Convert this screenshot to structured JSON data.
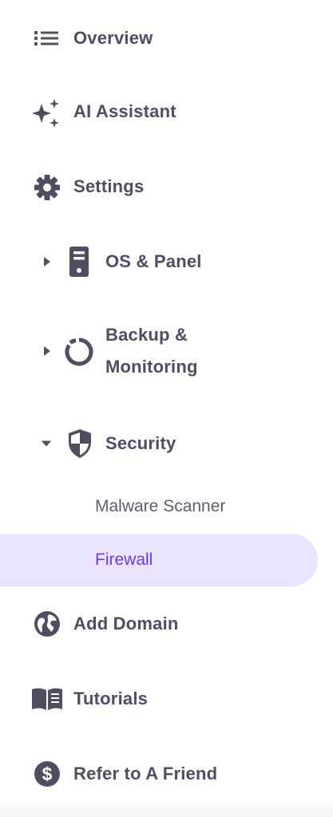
{
  "sidebar": {
    "accent_color": "#673de6",
    "active_bg_color": "#ebe4ff",
    "text_color": "#4f4e61",
    "items": {
      "overview": {
        "label": "Overview",
        "icon": "list-icon"
      },
      "ai_assistant": {
        "label": "AI Assistant",
        "icon": "sparkles-icon"
      },
      "settings": {
        "label": "Settings",
        "icon": "gear-icon"
      },
      "os_panel": {
        "label": "OS & Panel",
        "icon": "server-icon",
        "expanded": false
      },
      "backup": {
        "label_line1": "Backup &",
        "label_line2": "Monitoring",
        "icon": "backup-ring-icon",
        "expanded": false
      },
      "security": {
        "label": "Security",
        "icon": "shield-icon",
        "expanded": true,
        "children": [
          {
            "label": "Malware Scanner",
            "active": false
          },
          {
            "label": "Firewall",
            "active": true
          }
        ]
      },
      "add_domain": {
        "label": "Add Domain",
        "icon": "globe-icon"
      },
      "tutorials": {
        "label": "Tutorials",
        "icon": "book-icon"
      },
      "refer": {
        "label": "Refer to A Friend",
        "icon": "dollar-coin-icon"
      }
    }
  }
}
